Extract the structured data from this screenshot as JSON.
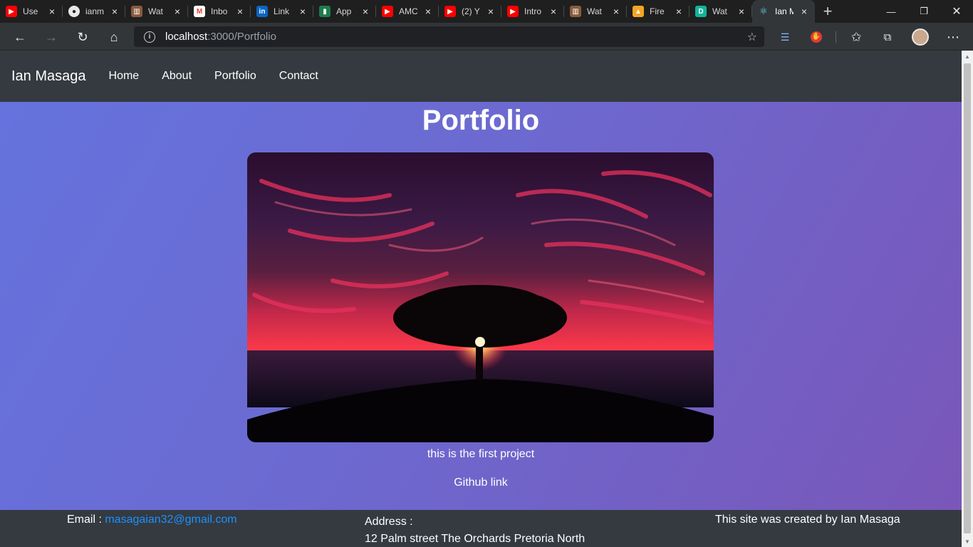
{
  "browser": {
    "tabs": [
      {
        "title": "Use",
        "icon": "youtube-icon",
        "color": "#ff0000"
      },
      {
        "title": "ianm",
        "icon": "github-icon",
        "color": "#5a5a5a"
      },
      {
        "title": "Wat",
        "icon": "film-icon",
        "color": "#8a5a3c"
      },
      {
        "title": "Inbo",
        "icon": "gmail-icon",
        "color": "#ea4335"
      },
      {
        "title": "Link",
        "icon": "linkedin-icon",
        "color": "#0a66c2"
      },
      {
        "title": "App",
        "icon": "app-icon",
        "color": "#1e7d4c"
      },
      {
        "title": "AMC",
        "icon": "youtube-icon",
        "color": "#ff0000"
      },
      {
        "title": "(2) Y",
        "icon": "youtube-icon",
        "color": "#ff0000"
      },
      {
        "title": "Intro",
        "icon": "youtube-icon",
        "color": "#ff0000"
      },
      {
        "title": "Wat",
        "icon": "film-icon",
        "color": "#8a5a3c"
      },
      {
        "title": "Fire",
        "icon": "firebase-icon",
        "color": "#f5a623"
      },
      {
        "title": "Wat",
        "icon": "d-icon",
        "color": "#13b39b"
      },
      {
        "title": "Ian M",
        "icon": "react-icon",
        "color": "#61dafb",
        "active": true
      }
    ],
    "url_host": "localhost",
    "url_rest": ":3000/Portfolio"
  },
  "nav": {
    "brand": "Ian Masaga",
    "links": [
      "Home",
      "About",
      "Portfolio",
      "Contact"
    ]
  },
  "main": {
    "title": "Portfolio",
    "project_description": "this is the first project",
    "github_link": "Github link"
  },
  "footer": {
    "email_label": "Email : ",
    "email": "masagaian32@gmail.com",
    "address_label": "Address :",
    "address": "12 Palm street The Orchards Pretoria North",
    "credit": "This site was created by Ian Masaga"
  },
  "colors": {
    "navbar": "#343a40",
    "link": "#1e90ff",
    "gradient_start": "#6573de",
    "gradient_end": "#7a56b8"
  }
}
